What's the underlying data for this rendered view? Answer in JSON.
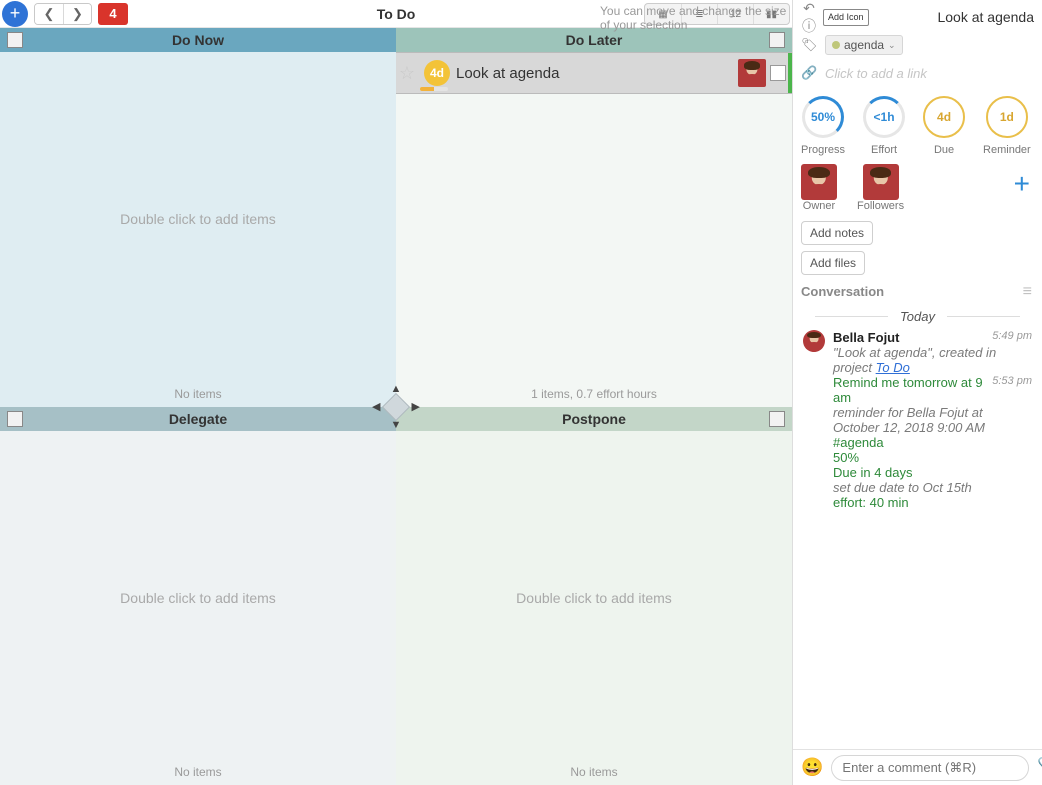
{
  "toolbar": {
    "count": "4",
    "title": "To Do",
    "hint": "You can move and change the size of your selection"
  },
  "quadrants": {
    "now": {
      "title": "Do Now",
      "placeholder": "Double click to add items",
      "footer": "No items"
    },
    "later": {
      "title": "Do Later",
      "placeholder": "",
      "footer": "1 items, 0.7 effort hours"
    },
    "delegate": {
      "title": "Delegate",
      "placeholder": "Double click to add items",
      "footer": "No items"
    },
    "postpone": {
      "title": "Postpone",
      "placeholder": "Double click to add items",
      "footer": "No items"
    }
  },
  "task": {
    "days": "4d",
    "label": "Look at agenda"
  },
  "detail": {
    "title": "Look at agenda",
    "add_icon": "Add Icon",
    "tag": "agenda",
    "link_ph": "Click to add a link",
    "metrics": {
      "progress": {
        "val": "50%",
        "label": "Progress"
      },
      "effort": {
        "val": "<1h",
        "label": "Effort"
      },
      "due": {
        "val": "4d",
        "label": "Due"
      },
      "reminder": {
        "val": "1d",
        "label": "Reminder"
      }
    },
    "owner_label": "Owner",
    "followers_label": "Followers",
    "add_notes": "Add notes",
    "add_files": "Add files",
    "conversation_label": "Conversation",
    "today": "Today",
    "msg": {
      "author": "Bella Fojut",
      "t1": "5:49 pm",
      "line1a": "\"Look at agenda\", created in project ",
      "line1b": "To Do",
      "t2": "5:53 pm",
      "line2": "Remind me tomorrow at 9 am",
      "line3": "reminder for Bella Fojut at October 12, 2018 9:00 AM",
      "line4": "#agenda",
      "line5": "50%",
      "line6": "Due in 4 days",
      "line7": "set due date to Oct 15th",
      "line8": "effort: 40 min"
    },
    "composer_ph": "Enter a comment (⌘R)"
  }
}
